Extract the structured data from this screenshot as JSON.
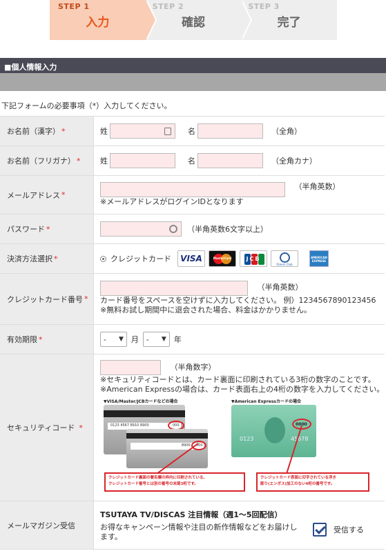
{
  "steps": [
    {
      "num": "STEP 1",
      "name": "入力"
    },
    {
      "num": "STEP 2",
      "name": "確認"
    },
    {
      "num": "STEP 3",
      "name": "完了"
    }
  ],
  "section_title": "■個人情報入力",
  "intro": "下記フォームの必要事項（*）入力してください。",
  "required_mark": "*",
  "fields": {
    "name_kanji": {
      "label": "お名前（漢字）",
      "sei": "姓",
      "mei": "名",
      "hint": "（全角）"
    },
    "name_kana": {
      "label": "お名前（フリガナ）",
      "sei": "姓",
      "mei": "名",
      "hint": "（全角カナ）"
    },
    "email": {
      "label": "メールアドレス",
      "hint": "（半角英数）",
      "note": "※メールアドレスがログインIDとなります"
    },
    "password": {
      "label": "パスワード",
      "hint": "（半角英数6文字以上）"
    },
    "payment": {
      "label": "決済方法選択",
      "option": "クレジットカード",
      "cards": [
        "VISA",
        "MasterCard",
        "JCB",
        "Diners Club",
        "AMERICAN EXPRESS"
      ]
    },
    "card_number": {
      "label": "クレジットカード番号",
      "hint": "（半角英数）",
      "note1": "カード番号をスペースを空けずに入力してください。 例）1234567890123456",
      "note2": "※無料お試し期間中に退会された場合、料金はかかりません。"
    },
    "expiry": {
      "label": "有効期限",
      "month_value": "-",
      "month_unit": "月",
      "year_value": "-",
      "year_unit": "年"
    },
    "security": {
      "label": "セキュリティコード",
      "hint": "（半角数字）",
      "note1": "※セキュリティコードとは、カード裏面に印刷されている3桁の数字のことです。",
      "note2": "※American Expressの場合は、カード表面右上の4桁の数字を入力してください。",
      "img_left_title": "▼VISA/Master/JCBカードなどの場合",
      "img_right_title": "▼American Expressカードの場合",
      "card_back_number": "0123 4567 8910 8900",
      "card_back_cvv": "000",
      "card_back_number2": "8900",
      "amex_code": "0000",
      "amex_num_left": "0123",
      "amex_num_right": "45678",
      "callout_left_1": "クレジットカード裏面の署名欄の枠内に印刷されている、",
      "callout_left_2": "クレジットカード番号とは別の番号の末尾3桁です。",
      "callout_right_1": "クレジットカード表面に印字されている浮き",
      "callout_right_2": "彫り(エンボス)加工のない4桁の番号です。"
    },
    "newsletter": {
      "label": "メールマガジン受信",
      "title": "TSUTAYA TV/DISCAS 注目情報（週1〜5回配信）",
      "desc1": "お得なキャンペーン情報や注目の新作情報などをお届けし",
      "desc2": "ます。",
      "check_label": "受信する"
    }
  },
  "colors": {
    "accent": "#e8581a",
    "required": "#e0262b",
    "header_bg": "#4a4a57",
    "input_bg": "#fde9ea",
    "label_bg": "#ececec",
    "callout": "#d8242a",
    "checkbox": "#2a4b8c"
  }
}
